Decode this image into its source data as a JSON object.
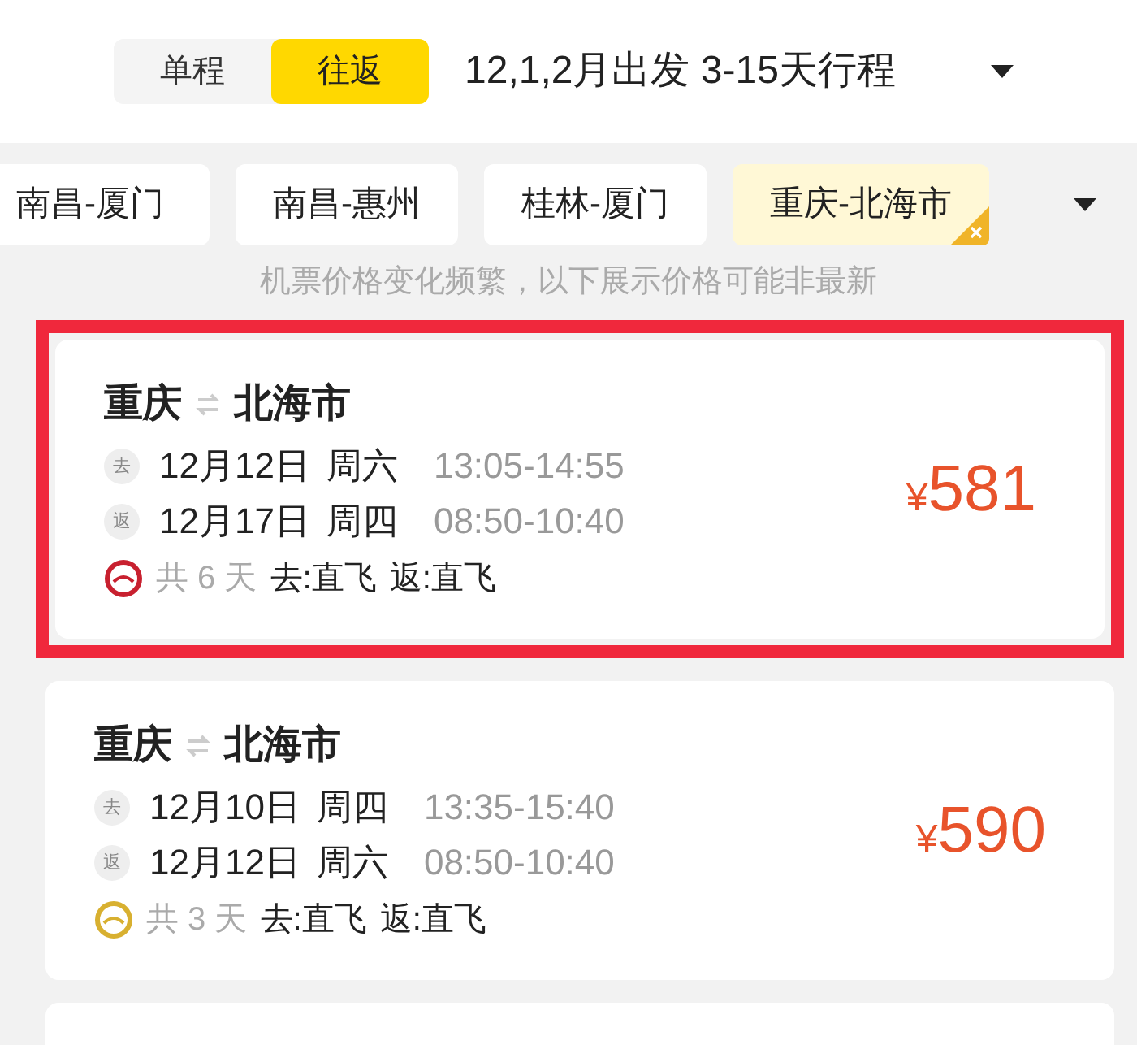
{
  "trip_type": [
    {
      "label": "单程",
      "selected": false
    },
    {
      "label": "往返",
      "selected": true
    }
  ],
  "date_filter": {
    "label": "12,1,2月出发 3-15天行程"
  },
  "routes": [
    {
      "label": "南昌-厦门",
      "selected": false
    },
    {
      "label": "南昌-惠州",
      "selected": false
    },
    {
      "label": "桂林-厦门",
      "selected": false
    },
    {
      "label": "重庆-北海市",
      "selected": true
    }
  ],
  "notice": "机票价格变化频繁，以下展示价格可能非最新",
  "tickets": [
    {
      "from": "重庆",
      "to": "北海市",
      "highlighted": true,
      "color": "#c8202f",
      "legs": [
        {
          "tag": "去",
          "date": "12月12日",
          "weekday": "周六",
          "time": "13:05-14:55"
        },
        {
          "tag": "返",
          "date": "12月17日",
          "weekday": "周四",
          "time": "08:50-10:40"
        }
      ],
      "duration": "共 6 天",
      "outbound": "去:直飞",
      "return": "返:直飞",
      "currency": "¥",
      "price": "581"
    },
    {
      "from": "重庆",
      "to": "北海市",
      "highlighted": false,
      "color": "#d8b030",
      "legs": [
        {
          "tag": "去",
          "date": "12月10日",
          "weekday": "周四",
          "time": "13:35-15:40"
        },
        {
          "tag": "返",
          "date": "12月12日",
          "weekday": "周六",
          "time": "08:50-10:40"
        }
      ],
      "duration": "共 3 天",
      "outbound": "去:直飞",
      "return": "返:直飞",
      "currency": "¥",
      "price": "590"
    }
  ]
}
